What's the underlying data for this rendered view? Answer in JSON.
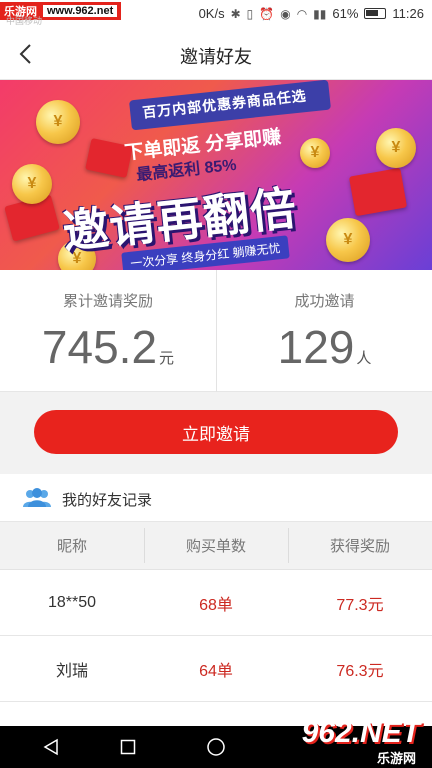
{
  "status_bar": {
    "carrier": "中国移动",
    "watermark_site": "乐游网",
    "watermark_url": "www.962.net",
    "speed": "0K/s",
    "battery": "61%",
    "time": "11:26"
  },
  "navbar": {
    "title": "邀请好友"
  },
  "banner": {
    "line1": "百万内部优惠券商品任选",
    "line2": "下单即返 分享即赚",
    "line3": "最高返利 85%",
    "headline": "邀请再翻倍",
    "tagline": "一次分享 终身分红 躺赚无忧"
  },
  "stats": {
    "reward_label": "累计邀请奖励",
    "reward_value": "745.2",
    "reward_unit": "元",
    "invited_label": "成功邀请",
    "invited_value": "129",
    "invited_unit": "人"
  },
  "invite_button": "立即邀请",
  "records": {
    "title": "我的好友记录",
    "columns": [
      "昵称",
      "购买单数",
      "获得奖励"
    ],
    "rows": [
      {
        "name": "18**50",
        "orders": "68单",
        "reward": "77.3元"
      },
      {
        "name": "刘瑞",
        "orders": "64单",
        "reward": "76.3元"
      },
      {
        "name": "",
        "orders": "",
        "reward": ""
      }
    ]
  },
  "watermark_bottom": {
    "big": "962.NET",
    "small": "乐游网"
  }
}
